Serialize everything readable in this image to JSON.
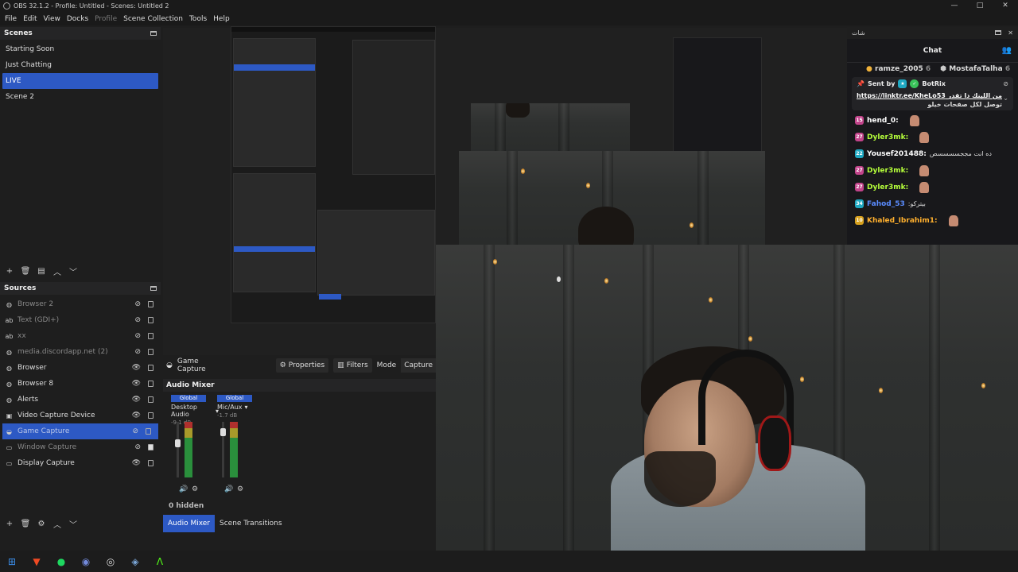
{
  "window": {
    "title": "OBS 32.1.2 - Profile: Untitled - Scenes: Untitled 2",
    "min": "—",
    "max": "□",
    "close": "✕"
  },
  "menu": [
    "File",
    "Edit",
    "View",
    "Docks",
    "Profile",
    "Scene Collection",
    "Tools",
    "Help"
  ],
  "scenes": {
    "header": "Scenes",
    "items": [
      "Starting Soon",
      "Just Chatting",
      "LIVE",
      "Scene 2"
    ],
    "active": "LIVE"
  },
  "sources": {
    "header": "Sources",
    "items": [
      {
        "label": "Browser 2",
        "icon": "globe-icon",
        "visible": false
      },
      {
        "label": "Text (GDI+)",
        "icon": "text-icon",
        "visible": false
      },
      {
        "label": "xx",
        "icon": "text-icon",
        "visible": false
      },
      {
        "label": "media.discordapp.net (2)",
        "icon": "globe-icon",
        "visible": false
      },
      {
        "label": "Browser",
        "icon": "globe-icon",
        "visible": true
      },
      {
        "label": "Browser 8",
        "icon": "globe-icon",
        "visible": true
      },
      {
        "label": "Alerts",
        "icon": "globe-icon",
        "visible": true
      },
      {
        "label": "Video Capture Device",
        "icon": "camera-icon",
        "visible": true
      },
      {
        "label": "Game Capture",
        "icon": "gamepad-icon",
        "visible": false
      },
      {
        "label": "Window Capture",
        "icon": "window-icon",
        "visible": false
      },
      {
        "label": "Display Capture",
        "icon": "monitor-icon",
        "visible": true
      }
    ],
    "active": "Game Capture"
  },
  "context_bar": {
    "source": "Game Capture",
    "properties": "Properties",
    "filters": "Filters",
    "mode_label": "Mode",
    "mode_value": "Capture"
  },
  "mixer": {
    "title": "Audio Mixer",
    "channels": [
      {
        "global": "Global",
        "name": "Desktop Audio",
        "db": "-9.1 dB"
      },
      {
        "global": "Global",
        "name": "Mic/Aux",
        "db": "-1.7 dB"
      }
    ],
    "hidden": "0 hidden"
  },
  "bottom_tabs": [
    "Audio Mixer",
    "Scene Transitions"
  ],
  "chat": {
    "window_title": "شات",
    "header": "Chat",
    "gifts": [
      {
        "name": "ramze_2005",
        "count": "6"
      },
      {
        "name": "MostafaTalha",
        "count": "6"
      }
    ],
    "pinned_by": "Sent by",
    "pinned_user": "BotRix",
    "pinned_link": "https://linktr.ee/KheLo53",
    "pinned_text_1": "من اللينك دا تقدر",
    "pinned_text_2": "توصل لكل صفحات خيلو",
    "messages": [
      {
        "badge": "15",
        "badge_color": "#c2448b",
        "user": "hend_0:",
        "color": "#ffffff",
        "text": "",
        "emote": true
      },
      {
        "badge": "27",
        "badge_color": "#c2448b",
        "user": "Dyler3mk:",
        "color": "#b6ff3b",
        "text": "",
        "emote": true
      },
      {
        "badge": "22",
        "badge_color": "#1fa8c2",
        "user": "Yousef201488:",
        "color": "#ffffff",
        "text": "ده انت مججسسسسص",
        "emote": false
      },
      {
        "badge": "27",
        "badge_color": "#c2448b",
        "user": "Dyler3mk:",
        "color": "#b6ff3b",
        "text": "",
        "emote": true
      },
      {
        "badge": "27",
        "badge_color": "#c2448b",
        "user": "Dyler3mk:",
        "color": "#b6ff3b",
        "text": "",
        "emote": true
      },
      {
        "badge": "34",
        "badge_color": "#1fa8c2",
        "user": "Fahod_53",
        "color": "#5a8cff",
        "text": ":بيتركو",
        "emote": false
      },
      {
        "badge": "10",
        "badge_color": "#d6a01e",
        "user": "Khaled_Ibrahim1:",
        "color": "#ffb02e",
        "text": "",
        "emote": true
      }
    ]
  },
  "taskbar": [
    "windows-icon",
    "brave-icon",
    "spotify-icon",
    "discord-icon",
    "obs-icon",
    "steam-icon",
    "terminal-icon"
  ],
  "colors": {
    "accent": "#2d59c4",
    "bg": "#1e1e1e"
  }
}
